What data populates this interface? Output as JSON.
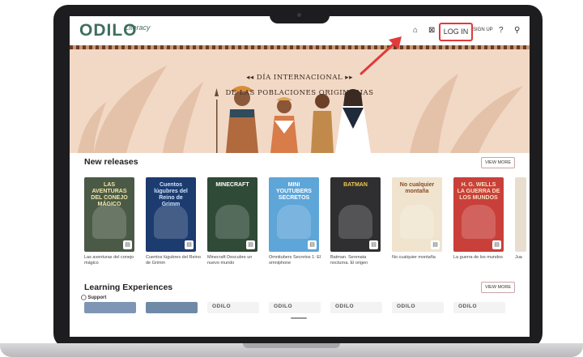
{
  "header": {
    "logo_text": "ODILO",
    "logo_sub": "Literacy",
    "home_icon": "home-icon",
    "login_label": "LOG IN",
    "signup_label": "SIGN UP",
    "help_icon": "help-icon",
    "search_icon": "search-icon"
  },
  "banner": {
    "line1": "◂◂ DÍA INTERNACIONAL ▸▸",
    "line2": "DE LAS POBLACIONES ORIGINARIAS"
  },
  "new_releases": {
    "title": "New releases",
    "view_more": "VIEW MORE",
    "books": [
      {
        "cover_title": "LAS AVENTURAS DEL CONEJO MÁGICO",
        "label": "Las aventuras del conejo mágico",
        "bg": "#4a5a46",
        "fg": "#f4e6a8"
      },
      {
        "cover_title": "Cuentos lúgubres del Reino de Grimm",
        "label": "Cuentos lúgubres del Reino de Grimm",
        "bg": "#1c3b6e",
        "fg": "#cfe3ff"
      },
      {
        "cover_title": "MINECRAFT",
        "label": "Minecraft Descubre un nuevo mundo",
        "bg": "#2f4a36",
        "fg": "#ffffff"
      },
      {
        "cover_title": "MINI YOUTUBERS SECRETOS",
        "label": "Omnitubers Secretos 1: El omniphone",
        "bg": "#5ea5d8",
        "fg": "#ffffff"
      },
      {
        "cover_title": "BATMAN",
        "label": "Batman. Serenata nocturna. El origen",
        "bg": "#2f2f31",
        "fg": "#f2c94c"
      },
      {
        "cover_title": "No cualquier montaña",
        "label": "No cualquier montaña",
        "bg": "#f0e4cf",
        "fg": "#8a4a2a"
      },
      {
        "cover_title": "H. G. WELLS LA GUERRA DE LOS MUNDOS",
        "label": "La guerra de los mundos",
        "bg": "#c9403a",
        "fg": "#f6e2c2"
      },
      {
        "cover_title": "",
        "label": "Jua",
        "bg": "#e8ded0",
        "fg": "#555555"
      }
    ]
  },
  "learning": {
    "title": "Learning Experiences",
    "view_more": "VIEW MORE",
    "support_label": "Support",
    "brand_tag": "ODILO"
  },
  "colors": {
    "brand": "#3e6f5e",
    "highlight": "#e03a3a",
    "banner_bg": "#f2d9c6"
  }
}
